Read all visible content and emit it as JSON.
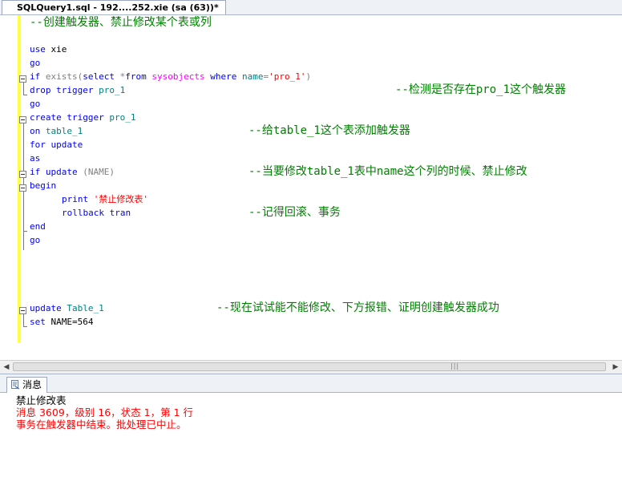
{
  "document_tab": {
    "title": "SQLQuery1.sql - 192....252.xie (sa (63))*"
  },
  "editor": {
    "header_comment": "--创建触发器、禁止修改某个表或列",
    "code": {
      "l_use_kw": "use",
      "l_use_db": " xie",
      "l_go1": "go",
      "l_if_kw": "if",
      "l_if_exists": " exists(",
      "l_if_select": "select",
      "l_if_star": " *",
      "l_if_from": "from",
      "l_if_sysobj": " sysobjects ",
      "l_if_where": "where",
      "l_if_name": " name",
      "l_if_eq": "=",
      "l_if_str": "'pro_1'",
      "l_if_close": ")",
      "l_drop_kw": "drop trigger",
      "l_drop_name": " pro_1",
      "l_go2": "go",
      "l_create_kw": "create trigger",
      "l_create_name": " pro_1",
      "l_on_kw": "on",
      "l_on_table": " table_1",
      "l_for": "for update",
      "l_as": "as",
      "l_ifu_kw": "if update",
      "l_ifu_col": " (NAME)",
      "l_begin": "begin",
      "l_print_kw": "print",
      "l_print_str": " '禁止修改表'",
      "l_rollback": "rollback tran",
      "l_end": "end",
      "l_go3": "go",
      "l_update_kw": "update",
      "l_update_table": " Table_1",
      "l_set_kw": "set",
      "l_set_rest": " NAME=564"
    },
    "comments": {
      "drop": "--检测是否存在pro_1这个触发器",
      "on": "--给table_1这个表添加触发器",
      "ifupdate": "--当要修改table_1表中name这个列的时候、禁止修改",
      "rollback": "--记得回滚、事务",
      "update": "--现在试试能不能修改、下方报错、证明创建触发器成功"
    }
  },
  "results": {
    "tab_label": "消息",
    "messages": [
      {
        "text": "禁止修改表",
        "color": "#000000"
      },
      {
        "text": "消息 3609，级别 16，状态 1，第 1 行",
        "color": "#ff0000"
      },
      {
        "text": "事务在触发器中结束。批处理已中止。",
        "color": "#ff0000"
      }
    ]
  },
  "colors": {
    "keyword": "#0000ff",
    "operator": "#808080",
    "identifier": "#008080",
    "system_object": "#ff00ff",
    "string": "#ff0000",
    "comment": "#008000",
    "change_bar": "#ffff44"
  }
}
